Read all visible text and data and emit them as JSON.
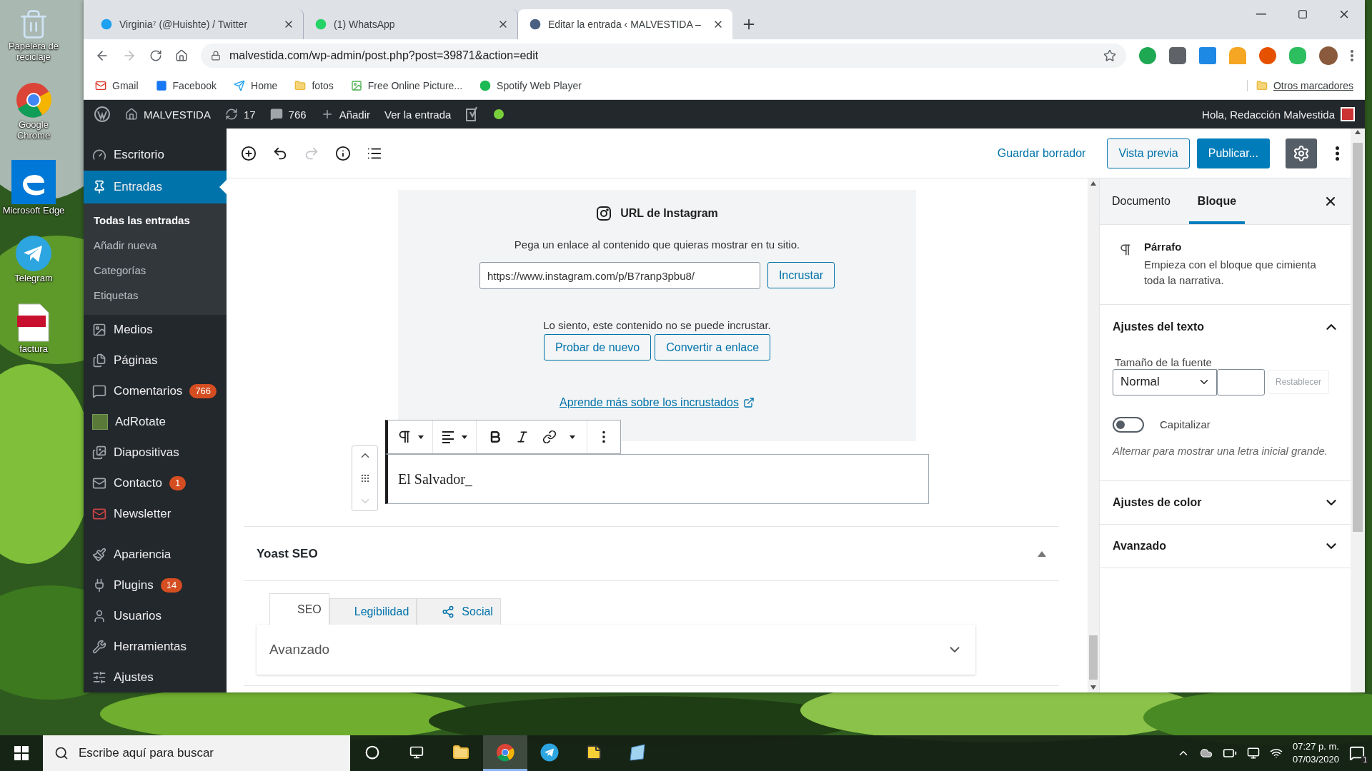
{
  "desktop": {
    "icons": [
      {
        "label": "Papelera de reciclaje"
      },
      {
        "label": "Google Chrome"
      },
      {
        "label": "Microsoft Edge"
      },
      {
        "label": "Telegram"
      },
      {
        "label": "factura"
      }
    ]
  },
  "browser": {
    "tabs": [
      {
        "title": "Virginia⁷ (@Huishte) / Twitter",
        "selected": false
      },
      {
        "title": "(1) WhatsApp",
        "selected": false
      },
      {
        "title": "Editar la entrada ‹ MALVESTIDA –",
        "selected": true
      }
    ],
    "url": "malvestida.com/wp-admin/post.php?post=39871&action=edit",
    "bookmarks": [
      {
        "label": "Gmail"
      },
      {
        "label": "Facebook"
      },
      {
        "label": "Home"
      },
      {
        "label": "fotos"
      },
      {
        "label": "Free Online Picture..."
      },
      {
        "label": "Spotify Web Player"
      }
    ],
    "other_bookmarks": "Otros marcadores"
  },
  "admin_bar": {
    "site": "MALVESTIDA",
    "updates": "17",
    "comments": "766",
    "add": "Añadir",
    "view": "Ver la entrada",
    "greeting": "Hola, Redacción Malvestida"
  },
  "sidebar": {
    "items": [
      {
        "label": "Escritorio",
        "selected": false
      },
      {
        "label": "Entradas",
        "selected": true,
        "children": [
          {
            "label": "Todas las entradas",
            "selected": true
          },
          {
            "label": "Añadir nueva",
            "selected": false
          },
          {
            "label": "Categorías",
            "selected": false
          },
          {
            "label": "Etiquetas",
            "selected": false
          }
        ]
      },
      {
        "label": "Medios",
        "selected": false
      },
      {
        "label": "Páginas",
        "selected": false
      },
      {
        "label": "Comentarios",
        "selected": false,
        "badge": "766"
      },
      {
        "label": "AdRotate",
        "selected": false
      },
      {
        "label": "Diapositivas",
        "selected": false
      },
      {
        "label": "Contacto",
        "selected": false,
        "badge": "1"
      },
      {
        "label": "Newsletter",
        "selected": false
      },
      {
        "label": "Apariencia",
        "selected": false
      },
      {
        "label": "Plugins",
        "selected": false,
        "badge": "14"
      },
      {
        "label": "Usuarios",
        "selected": false
      },
      {
        "label": "Herramientas",
        "selected": false
      },
      {
        "label": "Ajustes",
        "selected": false
      }
    ]
  },
  "editor_header": {
    "redo": {
      "disabled": true
    },
    "save_draft": "Guardar borrador",
    "preview": "Vista previa",
    "publish": "Publicar...",
    "settings": {
      "pressed": true
    }
  },
  "embed_block": {
    "title": "URL de Instagram",
    "instruction": "Pega un enlace al contenido que quieras mostrar en tu sitio.",
    "url_value": "https://www.instagram.com/p/B7ranp3pbu8/",
    "embed_button": "Incrustar",
    "error": "Lo siento, este contenido no se puede incrustar.",
    "retry_button": "Probar de nuevo",
    "convert_button": "Convertir a enlace",
    "learn_more": "Aprende más sobre los incrustados"
  },
  "paragraph_block": {
    "text": "El Salvador_"
  },
  "yoast": {
    "title": "Yoast SEO",
    "tabs": [
      {
        "label": "SEO",
        "selected": true
      },
      {
        "label": "Legibilidad",
        "selected": false
      },
      {
        "label": "Social",
        "selected": false
      }
    ],
    "section": "Avanzado"
  },
  "settings_panel": {
    "tabs": [
      {
        "label": "Documento",
        "selected": false
      },
      {
        "label": "Bloque",
        "selected": true
      }
    ],
    "block_name": "Párrafo",
    "block_description": "Empieza con el bloque que cimienta toda la narrativa.",
    "sections": [
      {
        "title": "Ajustes del texto",
        "expanded": true,
        "font_size_label": "Tamaño de la fuente",
        "font_size_value": "Normal",
        "reset_button": "Restablecer",
        "reset_disabled": true,
        "toggle_label": "Capitalizar",
        "toggle_on": false,
        "help": "Alternar para mostrar una letra inicial grande."
      },
      {
        "title": "Ajustes de color",
        "expanded": false
      },
      {
        "title": "Avanzado",
        "expanded": false
      }
    ]
  },
  "taskbar": {
    "search_placeholder": "Escribe aquí para buscar",
    "time": "07:27 p. m.",
    "date": "07/03/2020",
    "notifications": "1"
  }
}
